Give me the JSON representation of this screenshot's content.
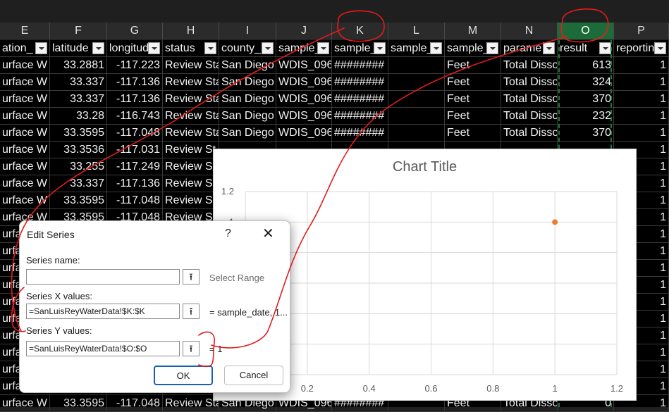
{
  "columns": [
    {
      "letter": "E",
      "width": 71,
      "header": "ation_",
      "selected": false
    },
    {
      "letter": "F",
      "width": 81,
      "header": "latitude",
      "selected": false
    },
    {
      "letter": "G",
      "width": 79,
      "header": "longitud",
      "selected": false
    },
    {
      "letter": "H",
      "width": 80,
      "header": "status",
      "selected": false
    },
    {
      "letter": "I",
      "width": 81,
      "header": "county_",
      "selected": false
    },
    {
      "letter": "J",
      "width": 79,
      "header": "sample_",
      "selected": false
    },
    {
      "letter": "K",
      "width": 80,
      "header": "sample_",
      "selected": false
    },
    {
      "letter": "L",
      "width": 80,
      "header": "sample_",
      "selected": false
    },
    {
      "letter": "M",
      "width": 80,
      "header": "sample_",
      "selected": false
    },
    {
      "letter": "N",
      "width": 80,
      "header": "parame",
      "selected": false
    },
    {
      "letter": "O",
      "width": 80,
      "header": "result",
      "selected": true
    },
    {
      "letter": "P",
      "width": 78,
      "header": "reportin",
      "selected": false
    }
  ],
  "rows": [
    [
      "urface W",
      "33.2881",
      "-117.223",
      "Review Sta",
      "San Diego",
      "WDIS_096",
      "########",
      "",
      "Feet",
      "Total Disso",
      "613",
      "1"
    ],
    [
      "urface W",
      "33.337",
      "-117.136",
      "Review Sta",
      "San Diego",
      "WDIS_096",
      "########",
      "",
      "Feet",
      "Total Disso",
      "324",
      "1"
    ],
    [
      "urface W",
      "33.337",
      "-117.136",
      "Review Sta",
      "San Diego",
      "WDIS_096",
      "########",
      "",
      "Feet",
      "Total Disso",
      "370",
      "1"
    ],
    [
      "urface W",
      "33.28",
      "-116.743",
      "Review Sta",
      "San Diego",
      "WDIS_096",
      "########",
      "",
      "Feet",
      "Total Disso",
      "232",
      "1"
    ],
    [
      "urface W",
      "33.3595",
      "-117.048",
      "Review Sta",
      "San Diego",
      "WDIS_096",
      "########",
      "",
      "Feet",
      "Total Disso",
      "370",
      "1"
    ],
    [
      "urface W",
      "33.3536",
      "-117.031",
      "Review St",
      "",
      "",
      "",
      "",
      "",
      "",
      "",
      "1"
    ],
    [
      "urface W",
      "33.255",
      "-117.249",
      "Review S",
      "",
      "",
      "",
      "",
      "",
      "",
      "",
      "1"
    ],
    [
      "urface W",
      "33.337",
      "-117.136",
      "Review S",
      "",
      "",
      "",
      "",
      "",
      "",
      "",
      "1"
    ],
    [
      "urface W",
      "33.3595",
      "-117.048",
      "Review S",
      "",
      "",
      "",
      "",
      "",
      "",
      "",
      "1"
    ],
    [
      "urface W",
      "33.3595",
      "-117.048",
      "Review S",
      "",
      "",
      "",
      "",
      "",
      "",
      "",
      "1"
    ],
    [
      "urfa",
      "",
      "",
      "",
      "",
      "",
      "",
      "",
      "",
      "",
      "",
      "1"
    ],
    [
      "urfa",
      "",
      "",
      "",
      "",
      "",
      "",
      "",
      "",
      "",
      "",
      "1"
    ],
    [
      "urfa",
      "",
      "",
      "",
      "",
      "",
      "",
      "",
      "",
      "",
      "",
      "1"
    ],
    [
      "urfa",
      "",
      "",
      "",
      "",
      "",
      "",
      "",
      "",
      "",
      "",
      "1"
    ],
    [
      "urfa",
      "",
      "",
      "",
      "",
      "",
      "",
      "",
      "",
      "",
      "",
      "1"
    ],
    [
      "urfa",
      "",
      "",
      "",
      "",
      "",
      "",
      "",
      "",
      "",
      "",
      "1"
    ],
    [
      "urfa",
      "",
      "",
      "",
      "",
      "",
      "",
      "",
      "",
      "",
      "",
      "1"
    ],
    [
      "urfa",
      "",
      "",
      "",
      "",
      "",
      "",
      "",
      "",
      "",
      "",
      "1"
    ],
    [
      "urfa",
      "",
      "",
      "",
      "",
      "",
      "",
      "",
      "",
      "",
      "",
      "1"
    ],
    [
      "urfa",
      "",
      "",
      "",
      "",
      "",
      "",
      "",
      "",
      "",
      "",
      "1"
    ],
    [
      "urface W",
      "33.3595",
      "-117.048",
      "Review Sta",
      "San Diego",
      "WDIS_096",
      "########",
      "",
      "Feet",
      "Total Disso",
      "0",
      "1"
    ]
  ],
  "chart_data": {
    "type": "scatter",
    "title": "Chart Title",
    "x": [
      1
    ],
    "y": [
      1
    ],
    "xlim": [
      0,
      1.2
    ],
    "ylim": [
      0,
      1.2
    ],
    "x_ticks": [
      "0.2",
      "0.4",
      "0.6",
      "0.8",
      "1",
      "1.2"
    ],
    "y_ticks": [
      "1.2",
      "1"
    ],
    "point_color": "#ed7d31",
    "grid": true
  },
  "dialog": {
    "title": "Edit Series",
    "help_glyph": "?",
    "close_glyph": "✕",
    "series_name_label": "Series name:",
    "series_name_value": "",
    "select_range": "Select Range",
    "x_label": "Series X values:",
    "x_value": "=SanLuisReyWaterData!$K:$K",
    "x_preview": "= sample_date, 1...",
    "y_label": "Series Y values:",
    "y_value": "=SanLuisReyWaterData!$O:$O",
    "y_preview": "= 1",
    "range_glyph": "⭱",
    "ok": "OK",
    "cancel": "Cancel"
  },
  "colors": {
    "grid_bg": "#000000",
    "selected_col": "#1e6b3a",
    "annotation": "#e31b1b"
  }
}
